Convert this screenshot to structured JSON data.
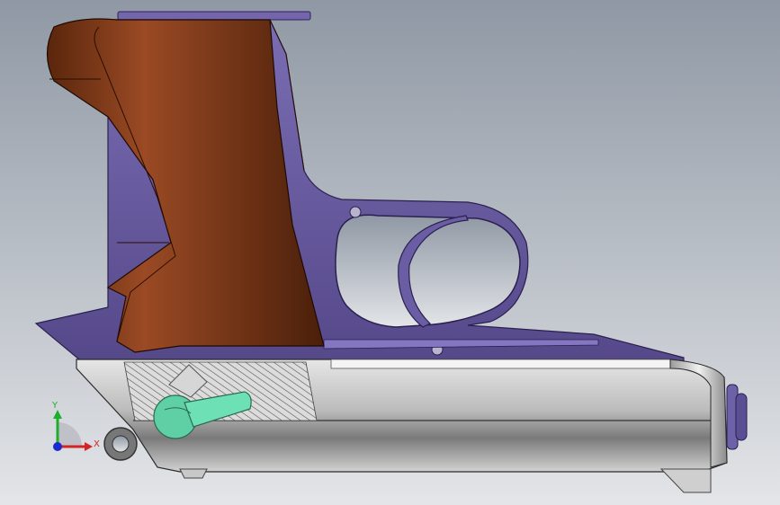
{
  "viewport": {
    "background_top": "#8f98a4",
    "background_bottom": "#e3e5e8"
  },
  "model": {
    "frame_color": "#6b5fa0",
    "frame_shadow": "#3d3168",
    "grip_color": "#4a1f0a",
    "grip_highlight": "#8a3c1a",
    "slide_color": "#b8b8b8",
    "slide_dark": "#6e6e6e",
    "lever_color": "#62d3a9"
  },
  "triad": {
    "y_label": "Y",
    "x_label": "X",
    "y_color": "#1fae2c",
    "x_color": "#d42424",
    "z_color": "#1a2ad0"
  }
}
